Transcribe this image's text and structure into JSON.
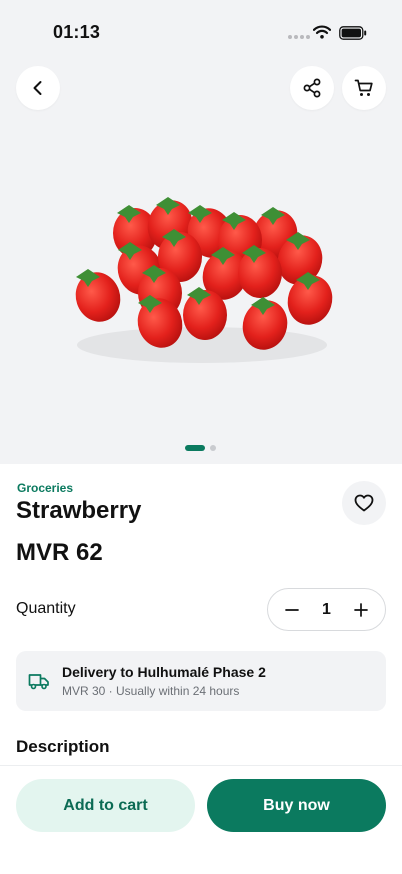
{
  "status_bar": {
    "time": "01:13"
  },
  "header": {
    "back_icon": "chevron-left-icon",
    "share_icon": "share-icon",
    "cart_icon": "cart-icon"
  },
  "gallery": {
    "image": "strawberries",
    "active_index": 1,
    "count": 2
  },
  "product": {
    "category": "Groceries",
    "name": "Strawberry",
    "price": "MVR 62",
    "favorite_icon": "heart-icon"
  },
  "quantity": {
    "label": "Quantity",
    "value": "1"
  },
  "delivery": {
    "icon": "truck-icon",
    "title": "Delivery to Hulhumalé Phase 2",
    "subtitle": "MVR 30 · Usually within 24 hours"
  },
  "description": {
    "heading": "Description"
  },
  "actions": {
    "add_to_cart": "Add to cart",
    "buy_now": "Buy now"
  },
  "colors": {
    "accent": "#0b7a5f",
    "accent_light": "#e3f5ef",
    "surface": "#f2f3f5"
  }
}
